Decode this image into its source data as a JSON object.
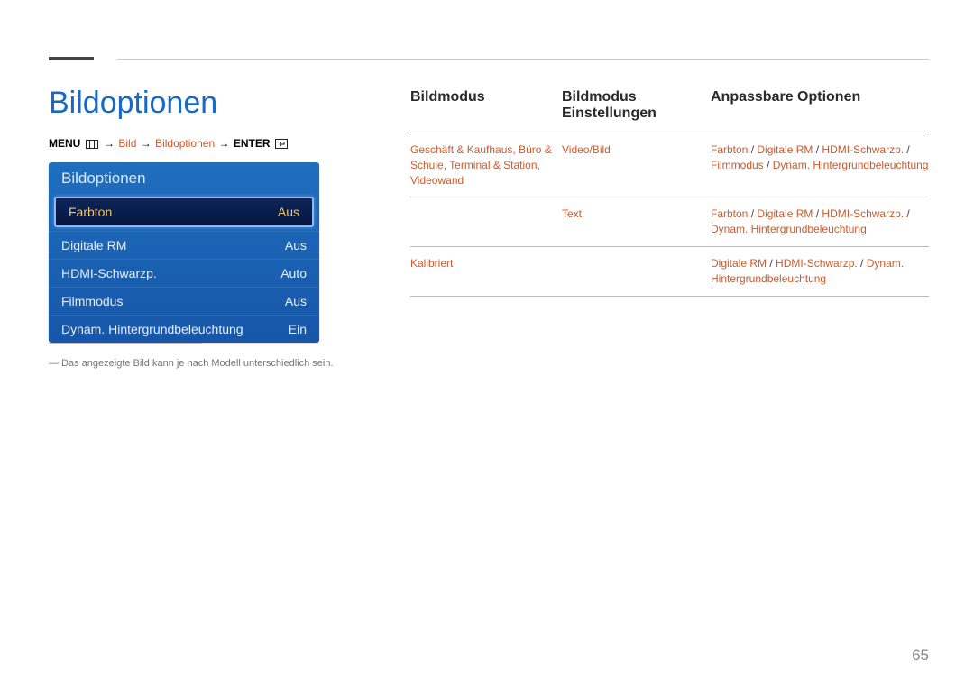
{
  "page_number": "65",
  "title": "Bildoptionen",
  "breadcrumb": {
    "menu": "MENU",
    "path1": "Bild",
    "path2": "Bildoptionen",
    "enter": "ENTER"
  },
  "panel": {
    "title": "Bildoptionen",
    "rows": [
      {
        "label": "Farbton",
        "value": "Aus",
        "selected": true
      },
      {
        "label": "Digitale RM",
        "value": "Aus",
        "selected": false
      },
      {
        "label": "HDMI-Schwarzp.",
        "value": "Auto",
        "selected": false
      },
      {
        "label": "Filmmodus",
        "value": "Aus",
        "selected": false
      },
      {
        "label": "Dynam. Hintergrundbeleuchtung",
        "value": "Ein",
        "selected": false
      }
    ]
  },
  "footnote": "― Das angezeigte Bild kann je nach Modell unterschiedlich sein.",
  "table": {
    "headers": {
      "col1": "Bildmodus",
      "col2": "Bildmodus Einstellungen",
      "col3": "Anpassbare Optionen"
    },
    "rows": [
      {
        "c1": "Geschäft & Kaufhaus, Büro & Schule, Terminal & Station, Videowand",
        "c2": "Video/Bild",
        "c3": [
          "Farbton",
          "Digitale RM",
          "HDMI-Schwarzp.",
          "Filmmodus",
          "Dynam. Hintergrundbeleuchtung"
        ]
      },
      {
        "c1": "",
        "c2": "Text",
        "c3": [
          "Farbton",
          "Digitale RM",
          "HDMI-Schwarzp.",
          "Dynam. Hintergrundbeleuchtung"
        ]
      },
      {
        "c1": "Kalibriert",
        "c2": "",
        "c3": [
          "Digitale RM",
          "HDMI-Schwarzp.",
          "Dynam. Hintergrundbeleuchtung"
        ]
      }
    ]
  }
}
